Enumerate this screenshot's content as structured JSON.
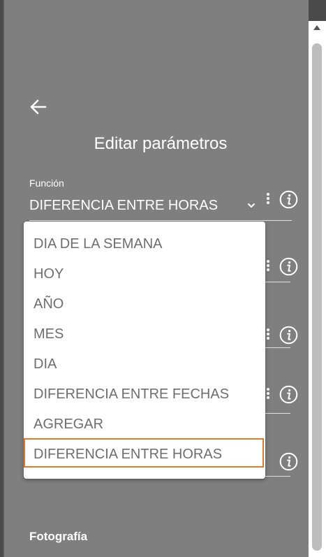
{
  "header": {
    "title": "Editar parámetros"
  },
  "field": {
    "label": "Función",
    "value": "DIFERENCIA ENTRE HORAS"
  },
  "dropdown": {
    "options": [
      "DIA DE LA SEMANA",
      "HOY",
      "AÑO",
      "MES",
      "DIA",
      "DIFERENCIA ENTRE FECHAS",
      "AGREGAR",
      "DIFERENCIA ENTRE HORAS"
    ],
    "selected_index": 7
  },
  "section": {
    "label": "Fotografía"
  },
  "icons": {
    "back": "arrow-left-icon",
    "chevron": "chevron-down-icon",
    "more": "more-vertical-icon",
    "info": "info-icon"
  },
  "colors": {
    "panel": "#7f7f7f",
    "selection_border": "#e07b2a",
    "dropdown_text": "#6e6e6e"
  }
}
